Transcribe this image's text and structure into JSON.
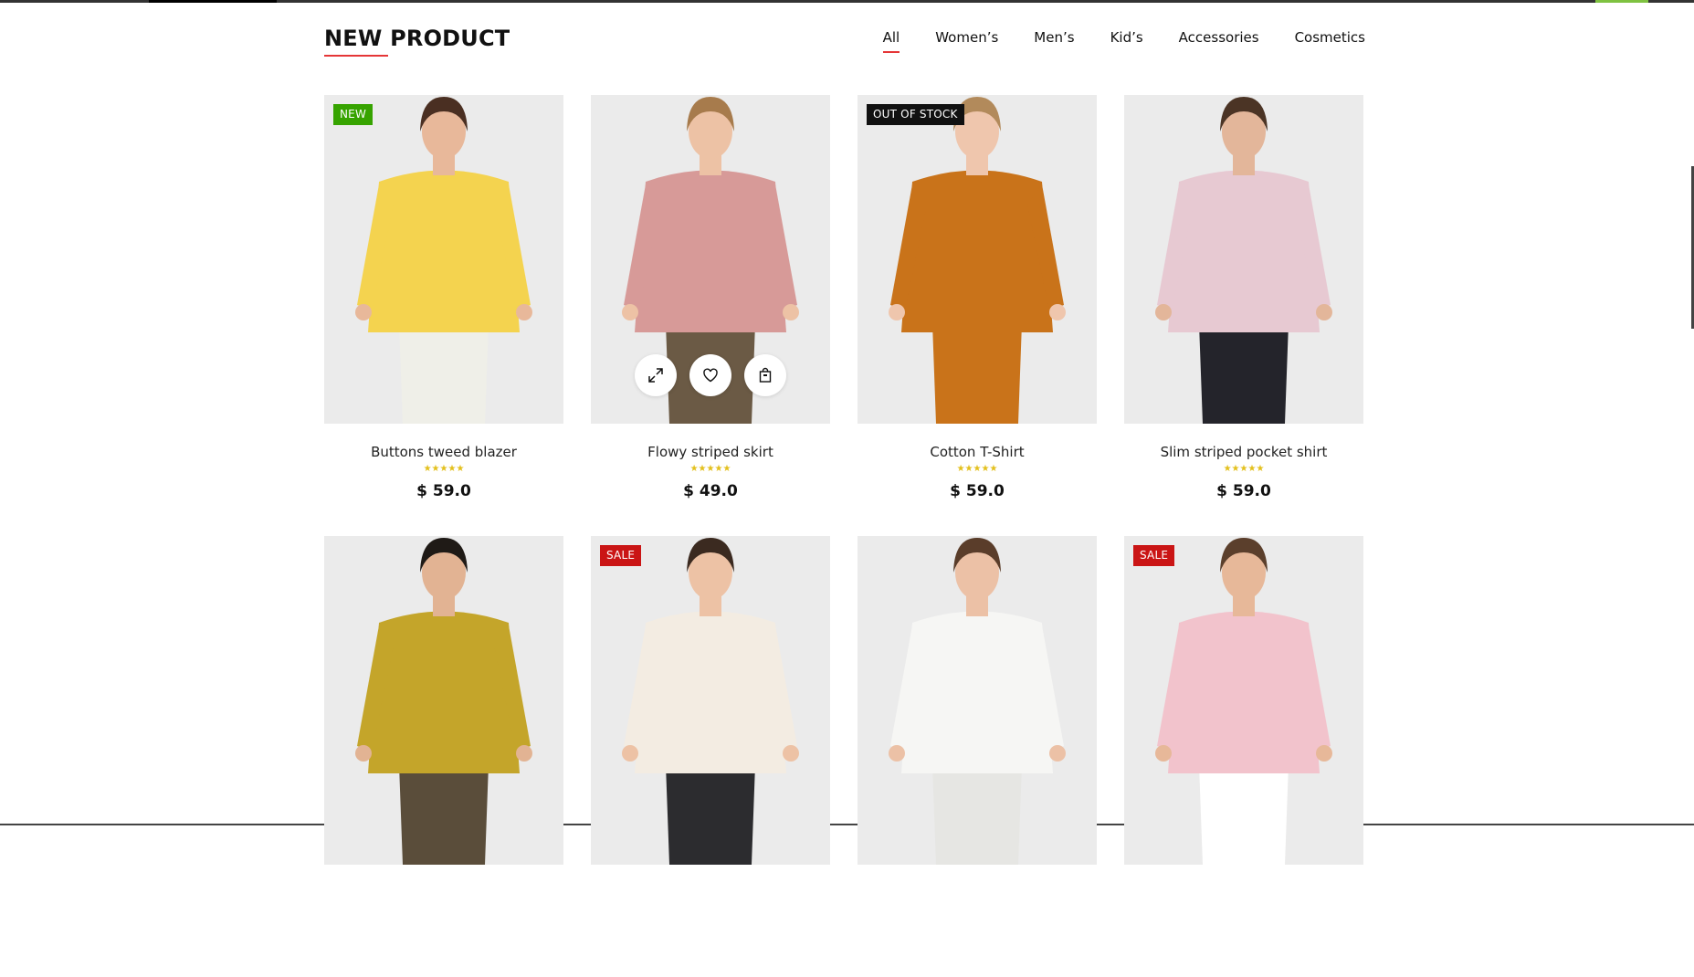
{
  "section": {
    "title": "NEW PRODUCT",
    "accent_color": "#e53637"
  },
  "filters": [
    {
      "label": "All",
      "active": true
    },
    {
      "label": "Women’s",
      "active": false
    },
    {
      "label": "Men’s",
      "active": false
    },
    {
      "label": "Kid’s",
      "active": false
    },
    {
      "label": "Accessories",
      "active": false
    },
    {
      "label": "Cosmetics",
      "active": false
    }
  ],
  "rating_stars": "★★★★★",
  "products": [
    {
      "name": "Buttons tweed blazer",
      "price": "$ 59.0",
      "badge": "NEW",
      "badge_color": "#36a300",
      "top_color": "#f4d34f",
      "bottom_color": "#efefe8",
      "skin": "#e8b89a",
      "hair": "#4a2f22"
    },
    {
      "name": "Flowy striped skirt",
      "price": "$ 49.0",
      "badge": "",
      "badge_color": "",
      "top_color": "#d79a98",
      "bottom_color": "#6b5a45",
      "skin": "#edc2a5",
      "hair": "#a77b4c",
      "hover": true
    },
    {
      "name": "Cotton T-Shirt",
      "price": "$ 59.0",
      "badge": "OUT OF STOCK",
      "badge_color": "#111111",
      "top_color": "#c9731a",
      "bottom_color": "#c9731a",
      "skin": "#efc6ad",
      "hair": "#b28a5b"
    },
    {
      "name": "Slim striped pocket shirt",
      "price": "$ 59.0",
      "badge": "",
      "badge_color": "",
      "top_color": "#e7c9d2",
      "bottom_color": "#24242b",
      "skin": "#e3b69a",
      "hair": "#4b3425"
    },
    {
      "name": "",
      "price": "",
      "badge": "",
      "badge_color": "",
      "top_color": "#c4a52a",
      "bottom_color": "#5a4d3a",
      "skin": "#e2b393",
      "hair": "#1f1a16"
    },
    {
      "name": "",
      "price": "",
      "badge": "SALE",
      "badge_color": "#ca1515",
      "top_color": "#f3ece2",
      "bottom_color": "#2c2c2f",
      "skin": "#edc2a5",
      "hair": "#3b2a20"
    },
    {
      "name": "",
      "price": "",
      "badge": "",
      "badge_color": "",
      "top_color": "#f6f6f4",
      "bottom_color": "#e6e6e3",
      "skin": "#ecc1a6",
      "hair": "#5a3d2a"
    },
    {
      "name": "",
      "price": "",
      "badge": "SALE",
      "badge_color": "#ca1515",
      "top_color": "#f2c3cc",
      "bottom_color": "#ffffff",
      "skin": "#e7b899",
      "hair": "#5b3f2c"
    }
  ],
  "icons": {
    "expand": "expand-icon",
    "wishlist": "heart-icon",
    "cart": "shopping-bag-icon"
  }
}
